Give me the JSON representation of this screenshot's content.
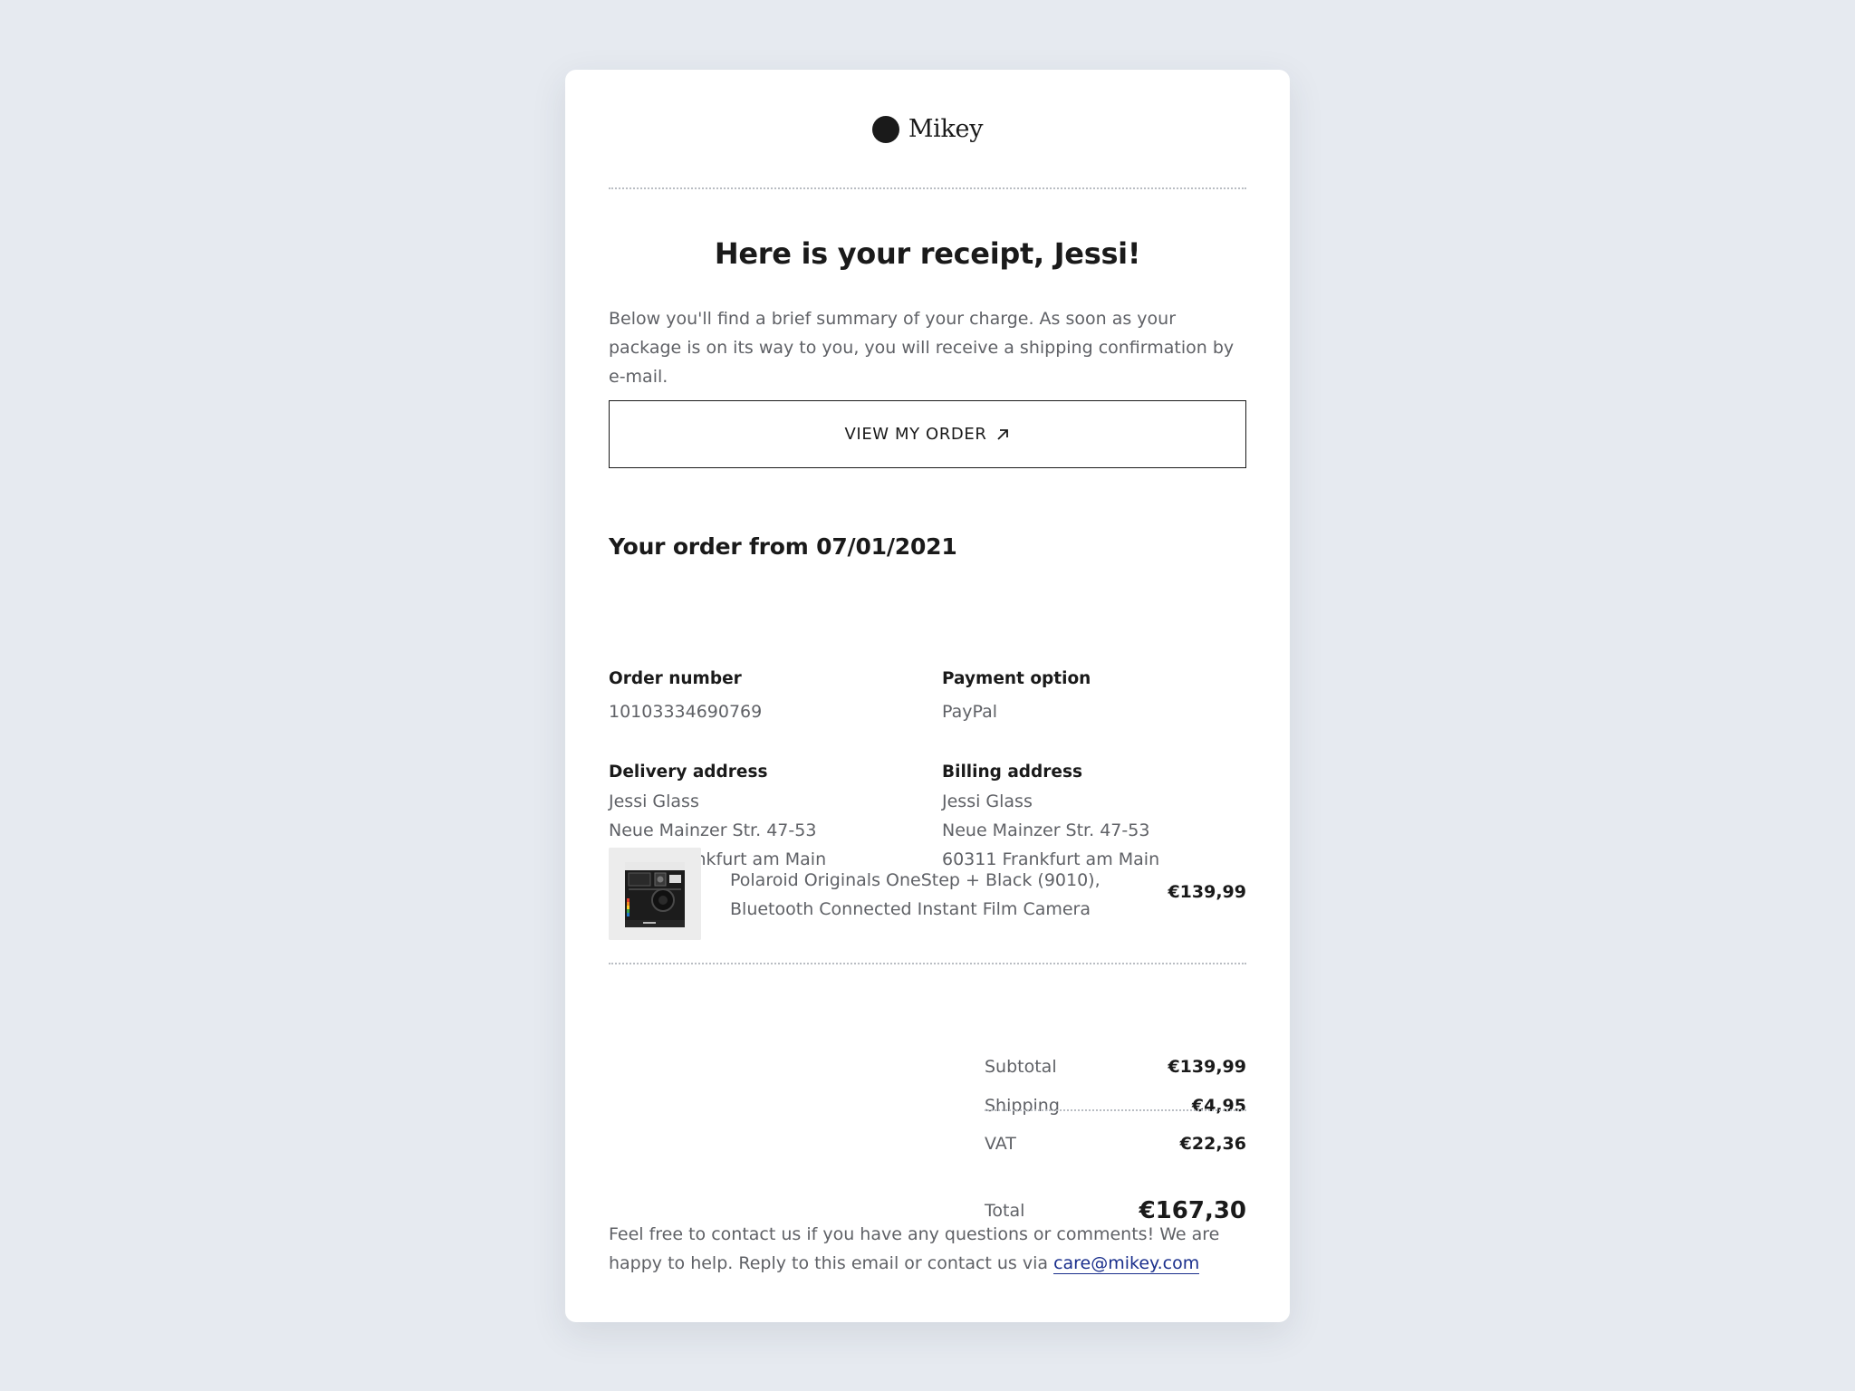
{
  "brand": {
    "name": "Mikey"
  },
  "header": {
    "headline": "Here is your receipt, Jessi!"
  },
  "intro": {
    "text": "Below you'll find a brief summary of your charge. As soon as your package is on its way to you, you will receive a shipping confirmation by e-mail."
  },
  "cta": {
    "label": "VIEW MY ORDER",
    "icon": "arrow-up-right-icon"
  },
  "order": {
    "title": "Your order from 07/01/2021",
    "number_label": "Order number",
    "number": "10103334690769",
    "payment_label": "Payment option",
    "payment": "PayPal",
    "delivery_label": "Delivery address",
    "delivery": {
      "name": "Jessi Glass",
      "street": "Neue Mainzer Str. 47-53",
      "city": "60311 Frankfurt am Main"
    },
    "billing_label": "Billing address",
    "billing": {
      "name": "Jessi Glass",
      "street": "Neue Mainzer Str. 47-53",
      "city": "60311 Frankfurt am Main"
    }
  },
  "product": {
    "line1": "Polaroid Originals OneStep + Black (9010),",
    "line2": "Bluetooth Connected Instant Film Camera",
    "price": "€139,99",
    "image": "instant-camera-image"
  },
  "summary": {
    "subtotal_label": "Subtotal",
    "subtotal": "€139,99",
    "shipping_label": "Shipping",
    "shipping": "€4,95",
    "vat_label": "VAT",
    "vat": "€22,36",
    "total_label": "Total",
    "total": "€167,30"
  },
  "footer": {
    "text": "Feel free to contact us if you have any questions or comments! We are happy to help. Reply to this email or contact us via",
    "email": "care@mikey.com",
    "link_color": "#1a2f8c"
  }
}
